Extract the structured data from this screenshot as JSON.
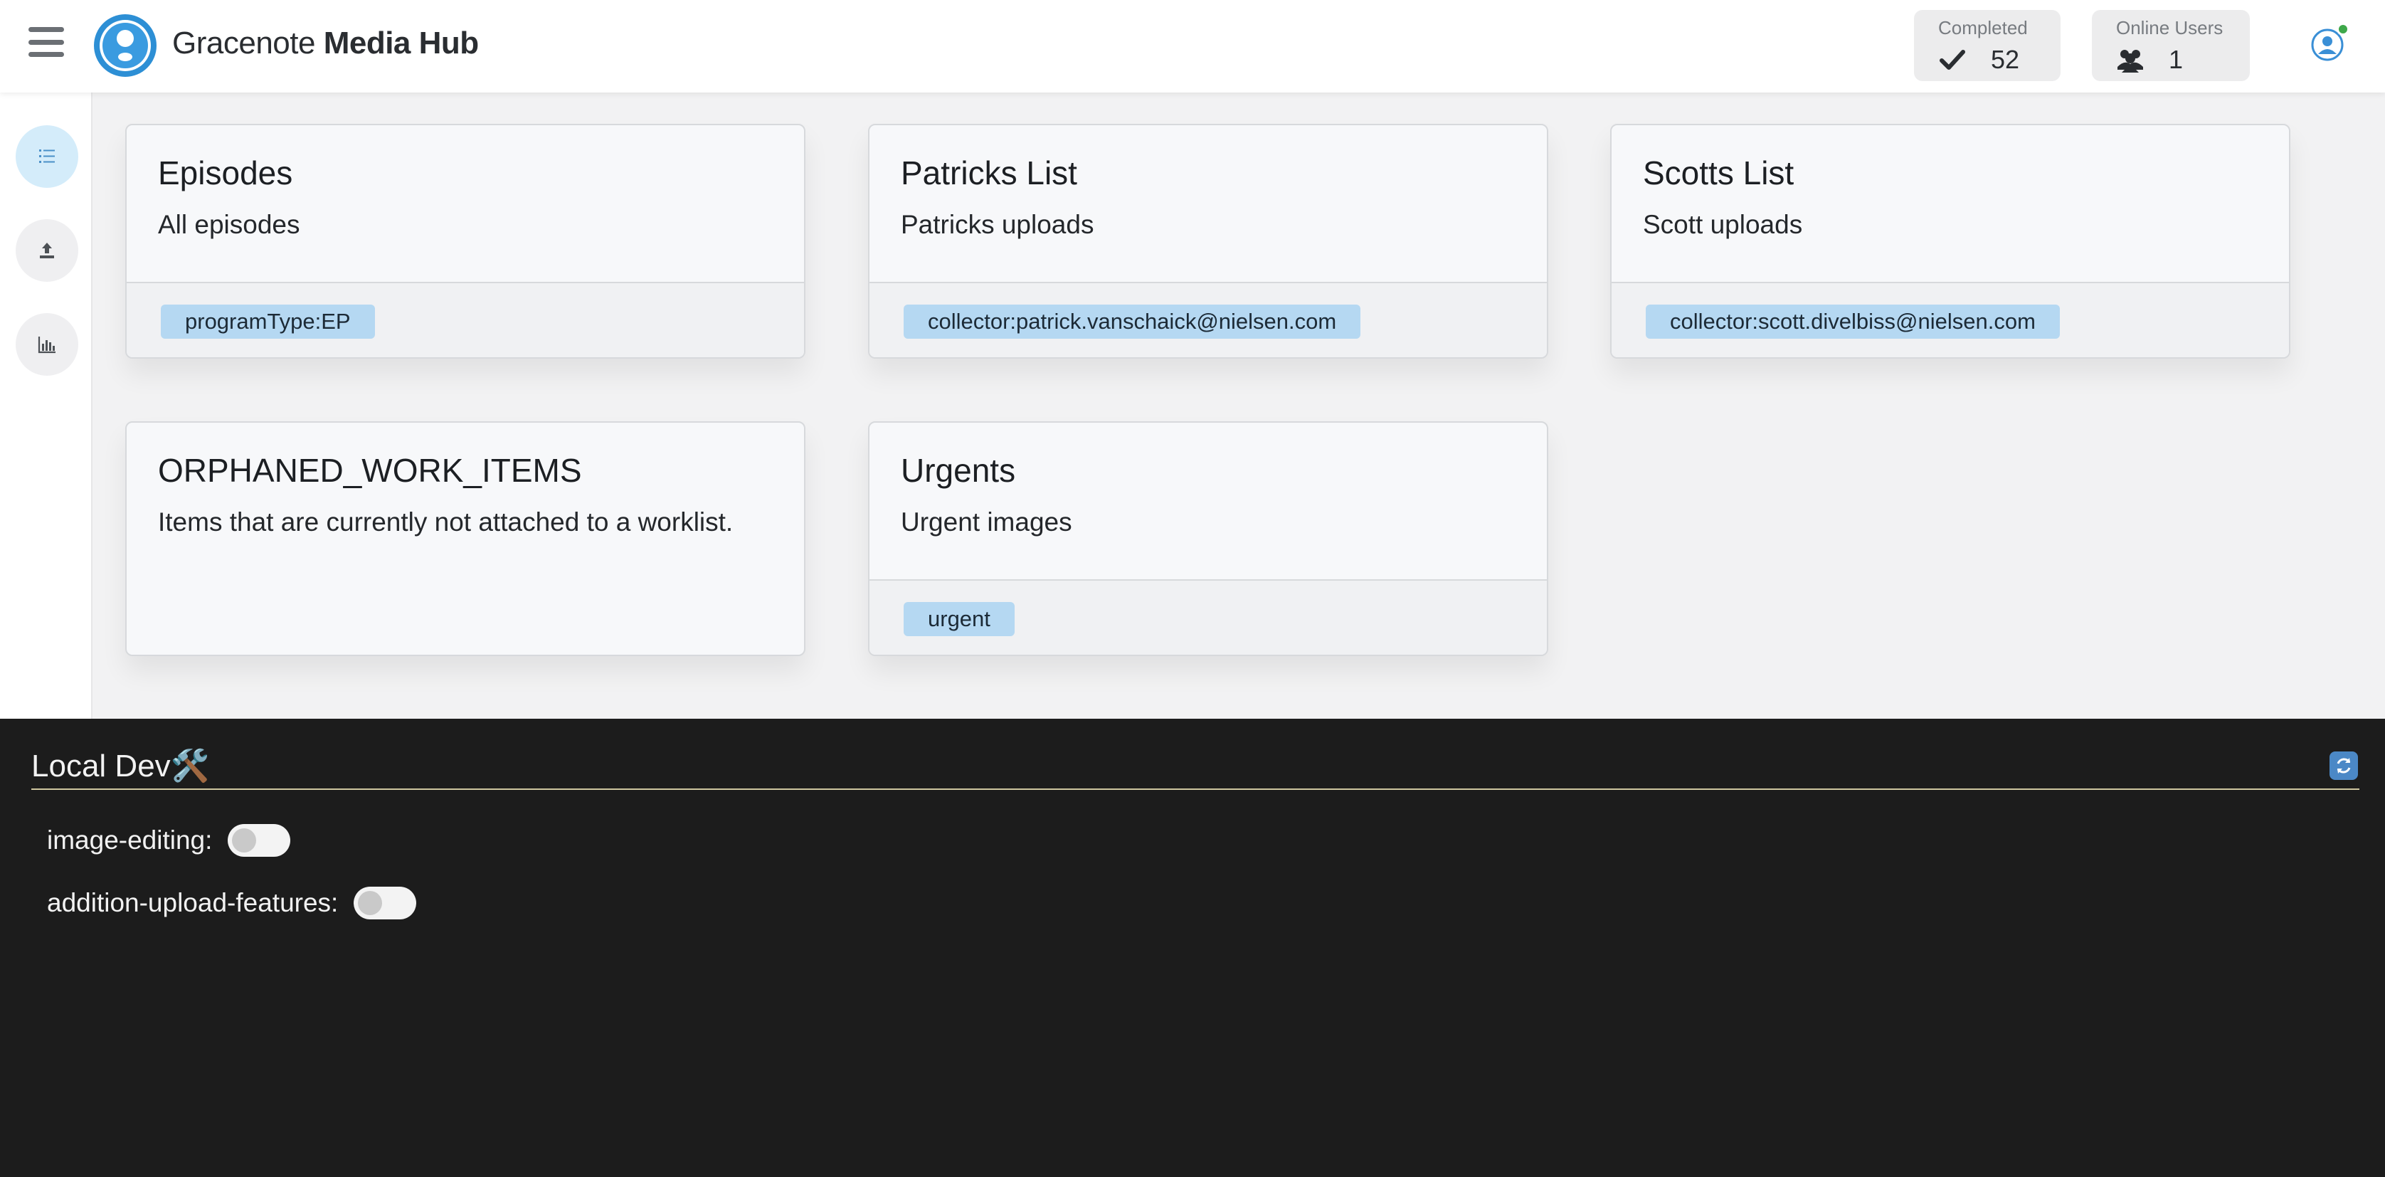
{
  "header": {
    "brand_regular": "Gracenote",
    "brand_bold": "Media Hub",
    "stats": [
      {
        "label": "Completed",
        "value": "52",
        "icon": "check-icon"
      },
      {
        "label": "Online Users",
        "value": "1",
        "icon": "users-icon"
      }
    ],
    "user_status_color": "#3ea84a"
  },
  "sidebar": {
    "items": [
      {
        "icon": "list-icon",
        "active": true
      },
      {
        "icon": "upload-icon",
        "active": false
      },
      {
        "icon": "bar-chart-icon",
        "active": false
      }
    ]
  },
  "worklists": [
    {
      "title": "Episodes",
      "description": "All episodes",
      "tags": [
        "programType:EP"
      ]
    },
    {
      "title": "Patricks List",
      "description": "Patricks uploads",
      "tags": [
        "collector:patrick.vanschaick@nielsen.com"
      ]
    },
    {
      "title": "Scotts List",
      "description": "Scott uploads",
      "tags": [
        "collector:scott.divelbiss@nielsen.com"
      ]
    },
    {
      "title": "ORPHANED_WORK_ITEMS",
      "description": "Items that are currently not attached to a worklist.",
      "tags": []
    },
    {
      "title": "Urgents",
      "description": "Urgent images",
      "tags": [
        "urgent"
      ]
    }
  ],
  "dev_panel": {
    "title": "Local Dev🛠️",
    "flags": [
      {
        "label": "image-editing:",
        "enabled": false
      },
      {
        "label": "addition-upload-features:",
        "enabled": false
      }
    ]
  },
  "colors": {
    "accent": "#2d8fd5",
    "chip": "#b5d8f2",
    "dev_panel_bg": "#1c1c1c"
  }
}
